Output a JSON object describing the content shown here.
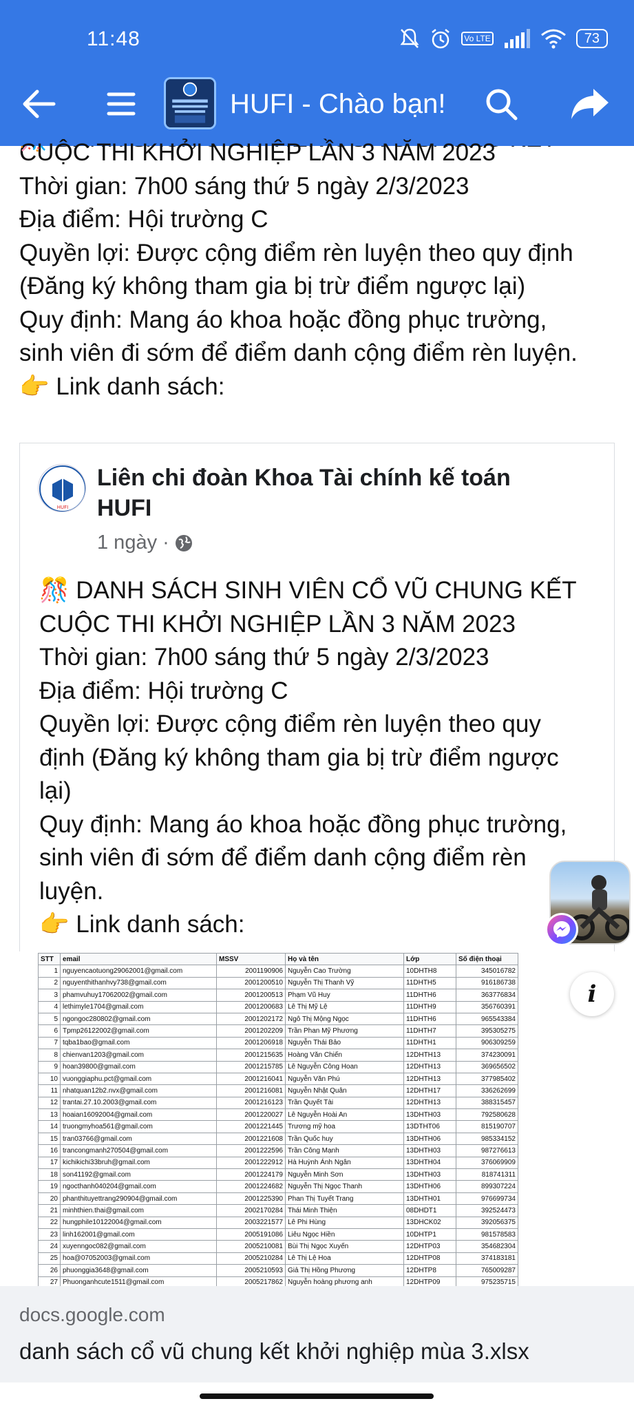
{
  "status_bar": {
    "time": "11:48",
    "battery": "73",
    "network": "Vo LTE"
  },
  "header": {
    "title": "HUFI - Chào bạn!"
  },
  "post": {
    "first_line": "🎊 DANH SÁCH SINH VIÊN CỔ VŨ CHUNG KẾT",
    "lines": [
      "CUỘC THI KHỞI NGHIỆP LẦN 3 NĂM 2023",
      "Thời gian: 7h00 sáng thứ 5 ngày 2/3/2023",
      "Địa điểm: Hội trường C",
      "Quyền lợi: Được cộng điểm rèn luyện theo quy định",
      "(Đăng ký không tham gia bị trừ điểm ngược lại)",
      "Quy định: Mang áo khoa hoặc đồng phục trường,",
      "sinh viên đi sớm để điểm danh cộng điểm rèn luyện.",
      "👉 Link danh sách:"
    ]
  },
  "shared_post": {
    "author": "Liên chi đoàn Khoa Tài chính kế toán HUFI",
    "time": "1 ngày",
    "lines": [
      "🎊 DANH SÁCH SINH VIÊN CỔ VŨ CHUNG KẾT",
      "CUỘC THI KHỞI NGHIỆP LẦN 3 NĂM 2023",
      "Thời gian: 7h00 sáng thứ 5 ngày 2/3/2023",
      "Địa điểm: Hội trường C",
      "Quyền lợi: Được cộng điểm rèn luyện theo quy",
      "định (Đăng ký không tham gia bị trừ điểm ngược",
      "lại)",
      "Quy định: Mang áo khoa hoặc đồng phục trường,",
      "sinh viên đi sớm để điểm danh cộng điểm rèn",
      "luyện.",
      "👉 Link danh sách:"
    ]
  },
  "sheet": {
    "headers": [
      "STT",
      "email",
      "MSSV",
      "Họ và tên",
      "Lớp",
      "Số điện thoại"
    ],
    "rows": [
      [
        "1",
        "nguyencaotuong29062001@gmail.com",
        "2001190906",
        "Nguyễn Cao Trường",
        "10DHTH8",
        "345016782"
      ],
      [
        "2",
        "nguyenthithanhvy738@gmail.com",
        "2001200510",
        "Nguyễn Thị Thanh Vỹ",
        "11DHTH5",
        "916186738"
      ],
      [
        "3",
        "phamvuhuy17062002@gmail.com",
        "2001200513",
        "Phạm Vũ Huy",
        "11DHTH6",
        "363776834"
      ],
      [
        "4",
        "lethimyle1704@gmail.com",
        "2001200683",
        "Lê Thị Mỹ Lệ",
        "11DHTH9",
        "356760391"
      ],
      [
        "5",
        "ngongoc280802@gmail.com",
        "2001202172",
        "Ngô Thị Mộng Ngọc",
        "11DHTH6",
        "965543384"
      ],
      [
        "6",
        "Tpmp26122002@gmail.com",
        "2001202209",
        "Trần Phan Mỹ Phương",
        "11DHTH7",
        "395305275"
      ],
      [
        "7",
        "tqba1bao@gmail.com",
        "2001206918",
        "Nguyễn Thái Bảo",
        "11DHTH1",
        "906309259"
      ],
      [
        "8",
        "chienvan1203@gmail.com",
        "2001215635",
        "Hoàng Văn Chiến",
        "12DHTH13",
        "374230091"
      ],
      [
        "9",
        "hoan39800@gmail.com",
        "2001215785",
        "Lê Nguyễn Công Hoan",
        "12DHTH13",
        "369656502"
      ],
      [
        "10",
        "vuonggiaphu.pct@gmail.com",
        "2001216041",
        "Nguyễn Văn Phú",
        "12DHTH13",
        "377985402"
      ],
      [
        "11",
        "nhatquan12b2.nvx@gmail.com",
        "2001216081",
        "Nguyễn Nhật Quân",
        "12DHTH17",
        "336262699"
      ],
      [
        "12",
        "trantai.27.10.2003@gmail.com",
        "2001216123",
        "Trần Quyết Tài",
        "12DHTH13",
        "388315457"
      ],
      [
        "13",
        "hoaian16092004@gmail.com",
        "2001220027",
        "Lê Nguyễn Hoài An",
        "13DHTH03",
        "792580628"
      ],
      [
        "14",
        "truongmyhoa561@gmail.com",
        "2001221445",
        "Trương mỹ hoa",
        "13DTHT06",
        "815190707"
      ],
      [
        "15",
        "tran03766@gmail.com",
        "2001221608",
        "Trần Quốc huy",
        "13DHTH06",
        "985334152"
      ],
      [
        "16",
        "trancongmanh270504@gmail.com",
        "2001222596",
        "Trần Công Mạnh",
        "13DHTH03",
        "987276613"
      ],
      [
        "17",
        "kichikichi33bruh@gmail.com",
        "2001222912",
        "Hà Huỳnh Ánh Ngân",
        "13DHTH04",
        "376069909"
      ],
      [
        "18",
        "son41192@gmail.com",
        "2001224179",
        "Nguyễn Minh Sơn",
        "13DHTH03",
        "818741311"
      ],
      [
        "19",
        "ngocthanh040204@gmail.com",
        "2001224682",
        "Nguyễn Thị Ngọc Thanh",
        "13DHTH06",
        "899307224"
      ],
      [
        "20",
        "phanthituyettrang290904@gmail.com",
        "2001225390",
        "Phan Thị Tuyết Trang",
        "13DHTH01",
        "976699734"
      ],
      [
        "21",
        "minhthien.thai@gmail.com",
        "2002170284",
        "Thái Minh Thiện",
        "08DHDT1",
        "392524473"
      ],
      [
        "22",
        "hungphile10122004@gmail.com",
        "2003221577",
        "Lê Phi Hùng",
        "13DHCK02",
        "392056375"
      ],
      [
        "23",
        "linh162001@gmail.com",
        "2005191086",
        "Liêu Ngọc Hiền",
        "10DHTP1",
        "981578583"
      ],
      [
        "24",
        "xuyenngoc082@gmail.com",
        "2005210081",
        "Bùi Thị Ngọc Xuyến",
        "12DHTP03",
        "354682304"
      ],
      [
        "25",
        "hoa@07052003@gmail.com",
        "2005210284",
        "Lê Thị Lệ Hoa",
        "12DHTP08",
        "374183181"
      ],
      [
        "26",
        "phuonggia3648@gmail.com",
        "2005210593",
        "Giả Thị Hồng Phương",
        "12DHTP8",
        "765009287"
      ],
      [
        "27",
        "Phuonganhcute1511@gmail.com",
        "2005217862",
        "Nguyễn hoàng phương anh",
        "12DHTP09",
        "975235715"
      ]
    ]
  },
  "link_preview": {
    "domain": "docs.google.com",
    "title": "danh sách cổ vũ chung kết khởi nghiệp mùa 3.xlsx"
  },
  "colors": {
    "header_bg": "#3578e5",
    "text": "#1c1e21",
    "muted": "#65676b",
    "footer_bg": "#f0f2f5"
  },
  "icons": [
    "back-arrow-icon",
    "menu-icon",
    "search-icon",
    "share-icon",
    "globe-icon",
    "messenger-icon",
    "info-icon"
  ]
}
